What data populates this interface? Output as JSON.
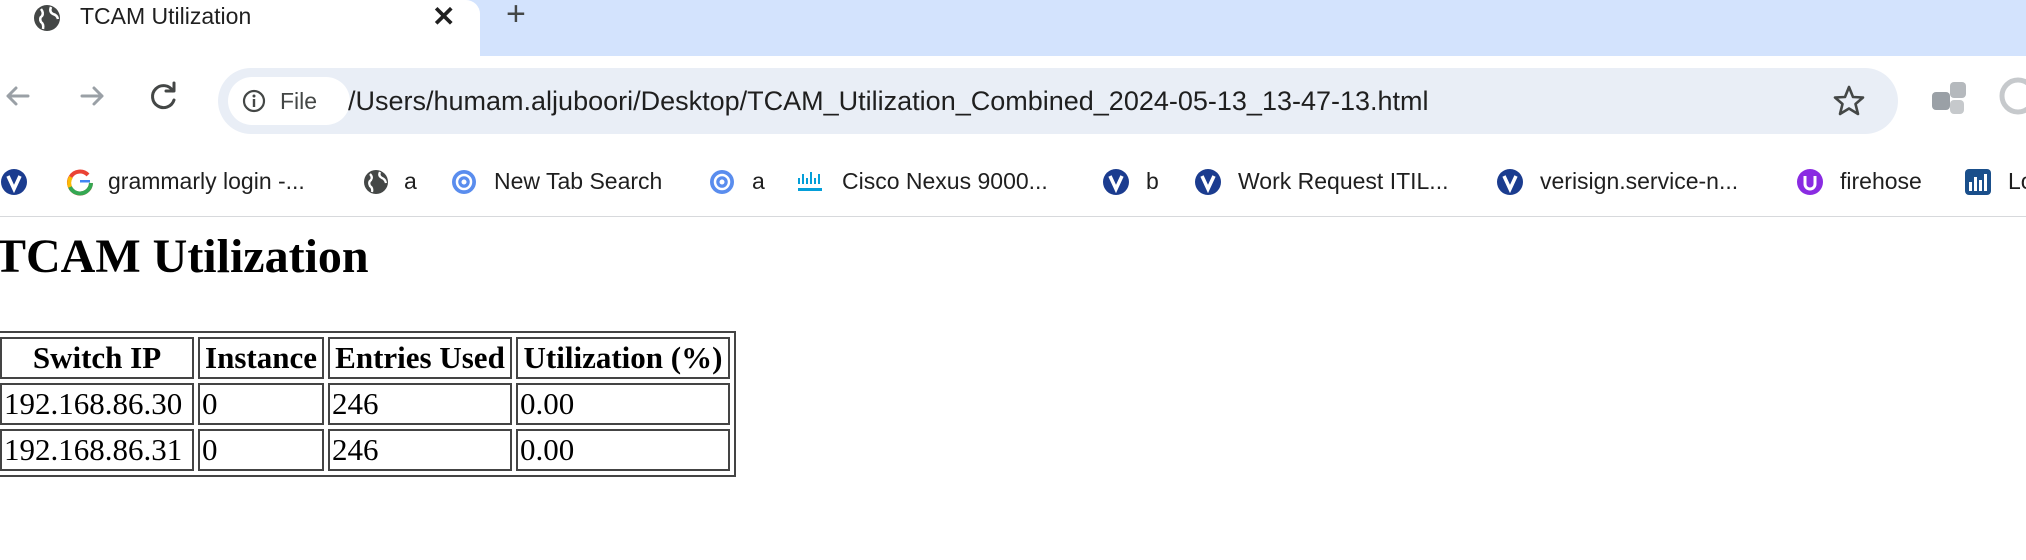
{
  "browser": {
    "tab": {
      "title": "TCAM Utilization",
      "icon": "globe-icon",
      "close_glyph": "✕"
    },
    "new_tab_glyph": "+",
    "toolbar": {
      "back_icon": "back-arrow-icon",
      "forward_icon": "forward-arrow-icon",
      "reload_icon": "reload-icon",
      "site_chip_label": "File",
      "url": "/Users/humam.aljuboori/Desktop/TCAM_Utilization_Combined_2024-05-13_13-47-13.html",
      "bookmark_icon": "star-icon"
    },
    "bookmarks": [
      {
        "label": "",
        "icon": "verisign-v-icon"
      },
      {
        "label": "grammarly login -...",
        "icon": "google-g-icon"
      },
      {
        "label": "a",
        "icon": "globe-icon"
      },
      {
        "label": "New Tab Search",
        "icon": "swirl-icon"
      },
      {
        "label": "a",
        "icon": "swirl-icon"
      },
      {
        "label": "Cisco Nexus 9000...",
        "icon": "cisco-icon"
      },
      {
        "label": "b",
        "icon": "verisign-v-icon"
      },
      {
        "label": "Work Request ITIL...",
        "icon": "verisign-v-icon"
      },
      {
        "label": "verisign.service-n...",
        "icon": "verisign-v-icon"
      },
      {
        "label": "firehose",
        "icon": "purple-u-icon"
      },
      {
        "label": "Lo",
        "icon": "chart-icon"
      }
    ]
  },
  "page": {
    "heading": "TCAM Utilization",
    "table": {
      "headers": [
        "Switch IP",
        "Instance",
        "Entries Used",
        "Utilization (%)"
      ],
      "rows": [
        [
          "192.168.86.30",
          "0",
          "246",
          "0.00"
        ],
        [
          "192.168.86.31",
          "0",
          "246",
          "0.00"
        ]
      ]
    }
  },
  "colors": {
    "tab_strip": "#d3e3fd",
    "omnibox": "#e9eef6",
    "verisign_blue": "#1b3c8f",
    "firehose_purple": "#8a2be2",
    "cisco_blue": "#049fd9"
  }
}
